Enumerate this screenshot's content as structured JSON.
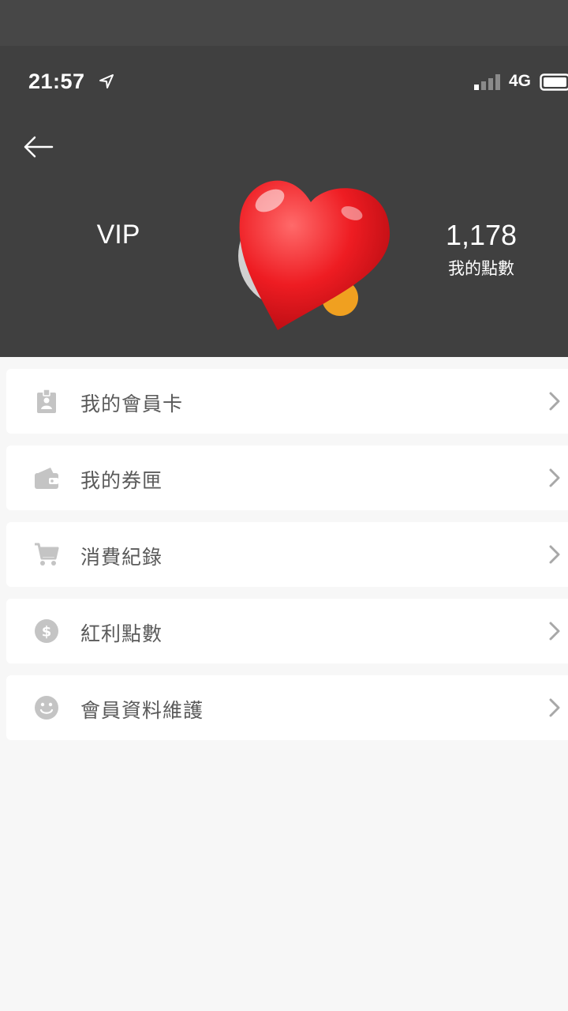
{
  "status_bar": {
    "time": "21:57",
    "network": "4G",
    "icons": [
      "location-arrow-icon",
      "signal-icon",
      "battery-icon"
    ]
  },
  "header": {
    "back_icon": "arrow-left-icon",
    "level": "VIP",
    "points_value": "1,178",
    "points_caption": "我的點數"
  },
  "menu": {
    "items": [
      {
        "label": "我的會員卡",
        "icon": "member-card-icon"
      },
      {
        "label": "我的券匣",
        "icon": "wallet-icon"
      },
      {
        "label": "消費紀錄",
        "icon": "cart-icon"
      },
      {
        "label": "紅利點數",
        "icon": "dollar-coin-icon"
      },
      {
        "label": "會員資料維護",
        "icon": "smiley-icon"
      }
    ],
    "chevron_icon": "chevron-right-icon"
  },
  "colors": {
    "header_bg": "#404040",
    "page_bg": "#f7f7f7",
    "item_bg": "#ffffff",
    "icon_gray": "#c4c4c4",
    "text_gray": "#5a5a5a",
    "badge_orange": "#f0a020",
    "heart_red": "#e8141c"
  }
}
